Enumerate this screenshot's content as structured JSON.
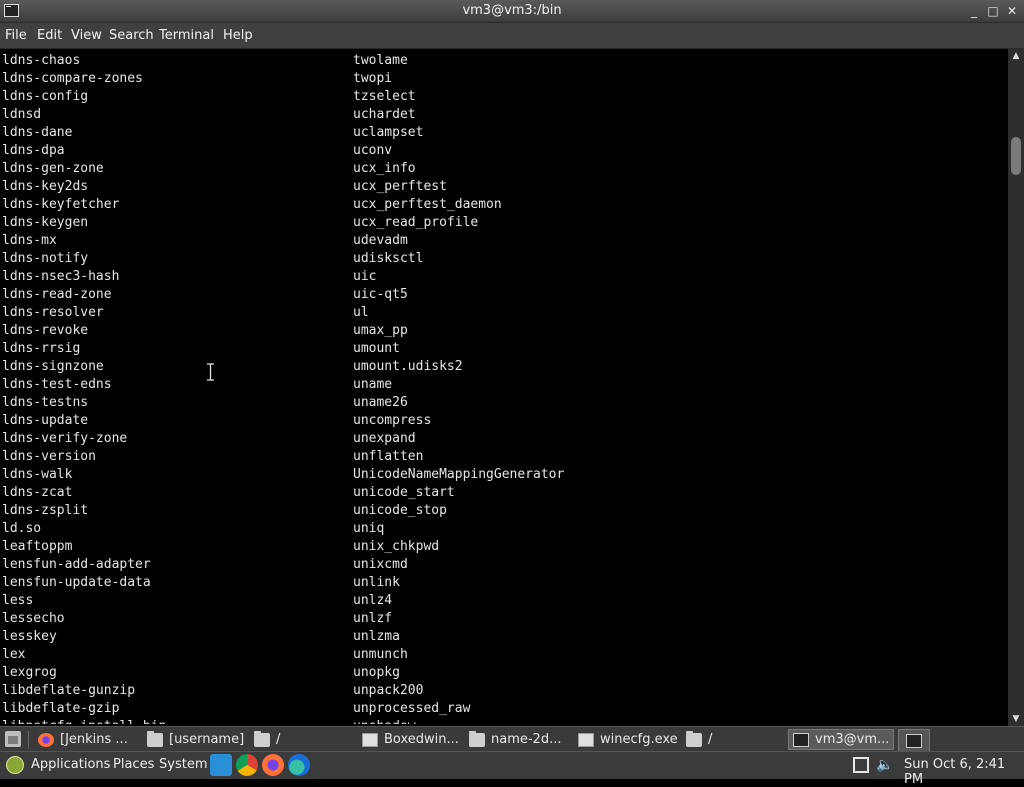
{
  "window": {
    "title": "vm3@vm3:/bin",
    "controls": {
      "minimize": "_",
      "maximize": "□",
      "close": "✕"
    }
  },
  "menubar": [
    "File",
    "Edit",
    "View",
    "Search",
    "Terminal",
    "Help"
  ],
  "terminal": {
    "left_column": [
      "ldns-chaos",
      "ldns-compare-zones",
      "ldns-config",
      "ldnsd",
      "ldns-dane",
      "ldns-dpa",
      "ldns-gen-zone",
      "ldns-key2ds",
      "ldns-keyfetcher",
      "ldns-keygen",
      "ldns-mx",
      "ldns-notify",
      "ldns-nsec3-hash",
      "ldns-read-zone",
      "ldns-resolver",
      "ldns-revoke",
      "ldns-rrsig",
      "ldns-signzone",
      "ldns-test-edns",
      "ldns-testns",
      "ldns-update",
      "ldns-verify-zone",
      "ldns-version",
      "ldns-walk",
      "ldns-zcat",
      "ldns-zsplit",
      "ld.so",
      "leaftoppm",
      "lensfun-add-adapter",
      "lensfun-update-data",
      "less",
      "lessecho",
      "lesskey",
      "lex",
      "lexgrog",
      "libdeflate-gunzip",
      "libdeflate-gzip"
    ],
    "left_cutoff": "libnetcfg-install-bin",
    "right_column": [
      "twolame",
      "twopi",
      "tzselect",
      "uchardet",
      "uclampset",
      "uconv",
      "ucx_info",
      "ucx_perftest",
      "ucx_perftest_daemon",
      "ucx_read_profile",
      "udevadm",
      "udisksctl",
      "uic",
      "uic-qt5",
      "ul",
      "umax_pp",
      "umount",
      "umount.udisks2",
      "uname",
      "uname26",
      "uncompress",
      "unexpand",
      "unflatten",
      "UnicodeNameMappingGenerator",
      "unicode_start",
      "unicode_stop",
      "uniq",
      "unix_chkpwd",
      "unixcmd",
      "unlink",
      "unlz4",
      "unlzf",
      "unlzma",
      "unmunch",
      "unopkg",
      "unpack200",
      "unprocessed_raw"
    ],
    "right_cutoff": "unshadow"
  },
  "taskbar": {
    "tasks": [
      {
        "label": "[Jenkins ...",
        "icon": "firefox-icon"
      },
      {
        "label": "[username]",
        "icon": "folder-icon"
      },
      {
        "label": "/",
        "icon": "folder-icon"
      },
      {
        "label": "Boxedwin...",
        "icon": "window-icon"
      },
      {
        "label": "name-2d...",
        "icon": "folder-icon"
      },
      {
        "label": "winecfg.exe",
        "icon": "window-icon"
      },
      {
        "label": "/",
        "icon": "folder-icon"
      },
      {
        "label": "vm3@vm...",
        "icon": "terminal-icon"
      }
    ]
  },
  "panel": {
    "menus": [
      "Applications",
      "Places",
      "System"
    ],
    "launchers": [
      "vscode-icon",
      "chrome-icon",
      "firefox-icon",
      "edge-dev-icon"
    ],
    "clock": "Sun Oct  6,  2:41 PM"
  }
}
